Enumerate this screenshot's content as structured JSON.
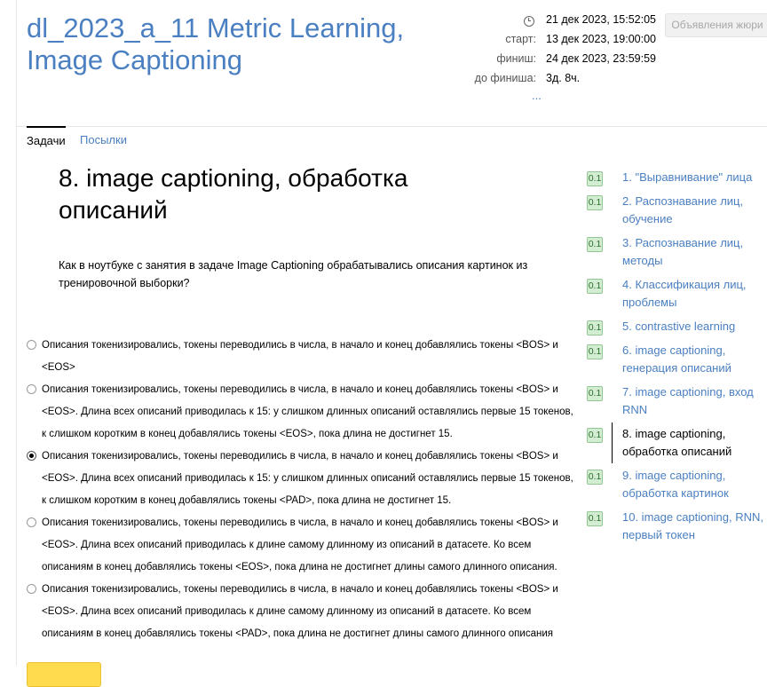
{
  "contest": {
    "title": "dl_2023_a_11 Metric Learning, Image Captioning",
    "current_time": "21 дек 2023, 15:52:05",
    "start_label": "старт:",
    "start_value": "13 дек 2023, 19:00:00",
    "finish_label": "финиш:",
    "finish_value": "24 дек 2023, 23:59:59",
    "remaining_label": "до финиша:",
    "remaining_value": "3д. 8ч.",
    "more": "...",
    "jury_button": "Объявления жюри"
  },
  "tabs": [
    {
      "label": "Задачи",
      "active": true
    },
    {
      "label": "Посылки",
      "active": false
    }
  ],
  "problem": {
    "title": "8. image captioning, обработка описаний",
    "question": "Как в ноутбуке с занятия в задаче Image Captioning обрабатывались описания картинок из тренировочной выборки?",
    "options": [
      {
        "text": "Описания токенизировались, токены переводились в числа, в начало и конец добавлялись токены <BOS> и <EOS>",
        "checked": false
      },
      {
        "text": "Описания токенизировались, токены переводились в числа, в начало и конец добавлялись токены <BOS> и <EOS>. Длина всех описаний приводилась к 15: у слишком длинных описаний оставлялись первые 15 токенов, к слишком коротким в конец добавлялись токены <EOS>, пока длина не достигнет 15.",
        "checked": false
      },
      {
        "text": "Описания токенизировались, токены переводились в числа, в начало и конец добавлялись токены <BOS> и <EOS>. Длина всех описаний приводилась к 15: у слишком длинных описаний оставлялись первые 15 токенов, к слишком коротким в конец добавлялись токены <PAD>, пока длина не достигнет 15.",
        "checked": true
      },
      {
        "text": "Описания токенизировались, токены переводились в числа, в начало и конец добавлялись токены <BOS> и <EOS>. Длина всех описаний приводилась к длине самому длинному из описаний в датасете. Ко всем описаниям в конец добавлялись токены <EOS>, пока длина не достигнет длины самого длинного описания.",
        "checked": false
      },
      {
        "text": "Описания токенизировались, токены переводились в числа, в начало и конец добавлялись токены <BOS> и <EOS>. Длина всех описаний приводилась к длине самому длинному из описаний в датасете. Ко всем описаниям в конец добавлялись токены <PAD>, пока длина не достигнет длины самого длинного описания",
        "checked": false
      }
    ]
  },
  "sidebar": {
    "items": [
      {
        "score": "0.1",
        "label": "1. \"Выравнивание\" лица",
        "active": false
      },
      {
        "score": "0.1",
        "label": "2. Распознавание лиц, обучение",
        "active": false
      },
      {
        "score": "0.1",
        "label": "3. Распознавание лиц, методы",
        "active": false
      },
      {
        "score": "0.1",
        "label": "4. Классификация лиц, проблемы",
        "active": false
      },
      {
        "score": "0.1",
        "label": "5. contrastive learning",
        "active": false
      },
      {
        "score": "0.1",
        "label": "6. image captioning, генерация описаний",
        "active": false
      },
      {
        "score": "0.1",
        "label": "7. image captioning, вход RNN",
        "active": false
      },
      {
        "score": "0.1",
        "label": "8. image captioning, обработка описаний",
        "active": true
      },
      {
        "score": "0.1",
        "label": "9. image captioning, обработка картинок",
        "active": false
      },
      {
        "score": "0.1",
        "label": "10. image captioning, RNN, первый токен",
        "active": false
      }
    ]
  }
}
